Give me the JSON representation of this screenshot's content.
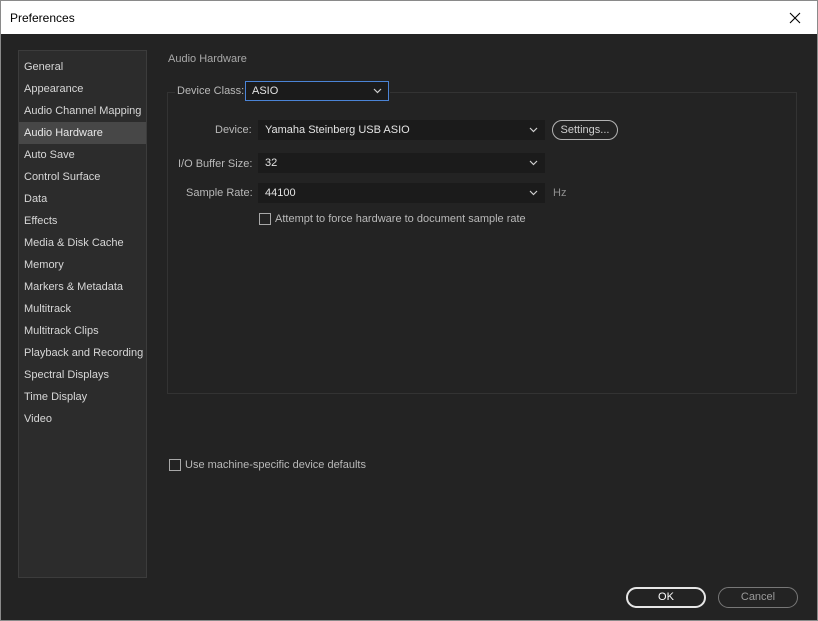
{
  "window": {
    "title": "Preferences"
  },
  "sidebar": {
    "items": [
      {
        "label": "General"
      },
      {
        "label": "Appearance"
      },
      {
        "label": "Audio Channel Mapping"
      },
      {
        "label": "Audio Hardware"
      },
      {
        "label": "Auto Save"
      },
      {
        "label": "Control Surface"
      },
      {
        "label": "Data"
      },
      {
        "label": "Effects"
      },
      {
        "label": "Media & Disk Cache"
      },
      {
        "label": "Memory"
      },
      {
        "label": "Markers & Metadata"
      },
      {
        "label": "Multitrack"
      },
      {
        "label": "Multitrack Clips"
      },
      {
        "label": "Playback and Recording"
      },
      {
        "label": "Spectral Displays"
      },
      {
        "label": "Time Display"
      },
      {
        "label": "Video"
      }
    ],
    "active_index": 3
  },
  "panel": {
    "section_title": "Audio Hardware",
    "device_class": {
      "label": "Device Class:",
      "value": "ASIO"
    },
    "device": {
      "label": "Device:",
      "value": "Yamaha Steinberg USB ASIO",
      "settings_label": "Settings..."
    },
    "buffer_size": {
      "label": "I/O Buffer Size:",
      "value": "32"
    },
    "sample_rate": {
      "label": "Sample Rate:",
      "value": "44100",
      "unit": "Hz"
    },
    "force_rate": {
      "label": "Attempt to force hardware to document sample rate",
      "checked": false
    },
    "machine_defaults": {
      "label": "Use machine-specific device defaults",
      "checked": false
    }
  },
  "footer": {
    "ok_label": "OK",
    "cancel_label": "Cancel"
  },
  "colors": {
    "background": "#232323",
    "sidebar_bg": "#2c2c2c",
    "active_item": "#474747",
    "focus_border": "#4b84d6"
  },
  "icons": {
    "close": "close-icon",
    "dropdown": "chevron-down-icon"
  }
}
